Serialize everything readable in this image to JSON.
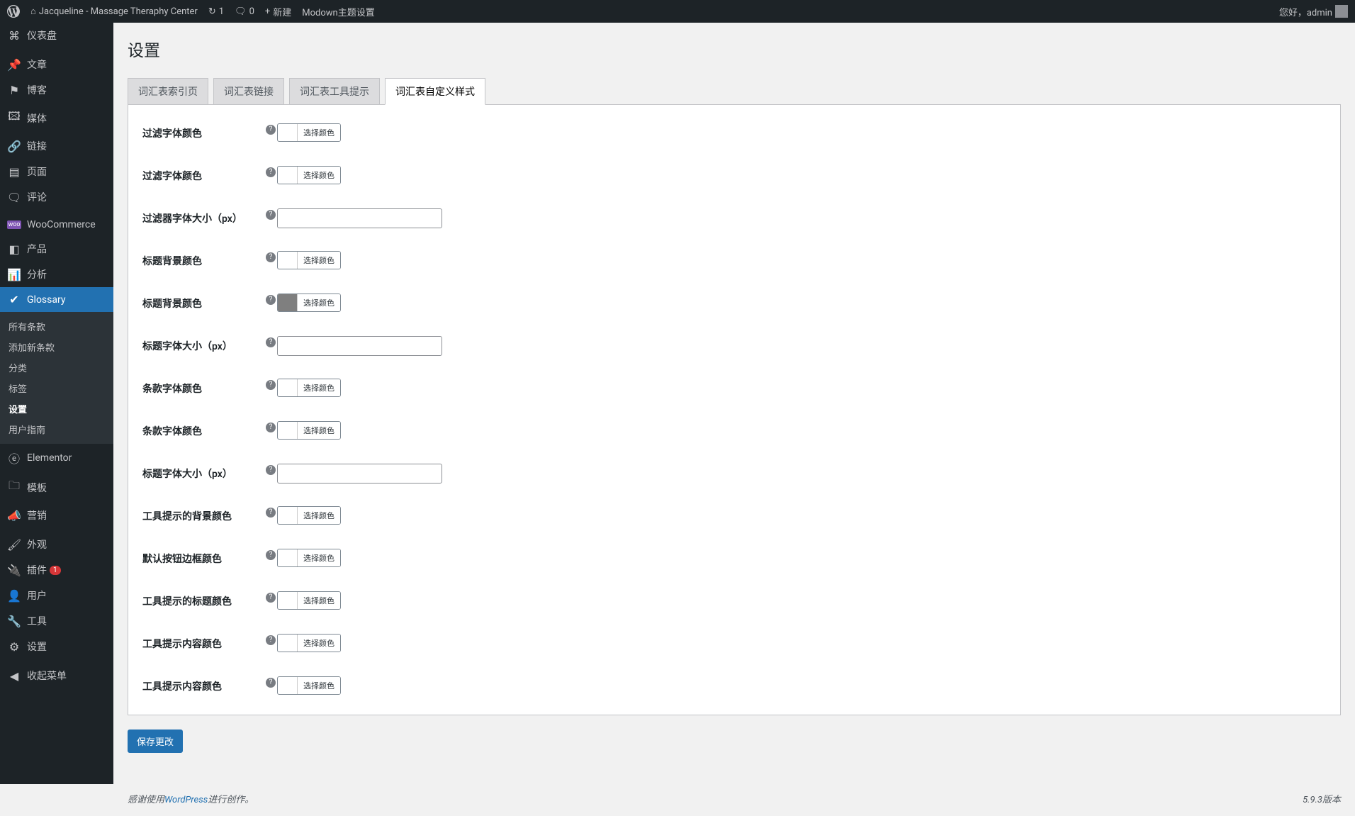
{
  "adminbar": {
    "site_name": "Jacqueline - Massage Theraphy Center",
    "updates": "1",
    "comments": "0",
    "new": "新建",
    "modown": "Modown主题设置",
    "howdy": "您好，admin"
  },
  "sidebar": {
    "dashboard": "仪表盘",
    "posts": "文章",
    "blog": "博客",
    "media": "媒体",
    "links": "链接",
    "pages": "页面",
    "comments": "评论",
    "woocommerce": "WooCommerce",
    "products": "产品",
    "analytics": "分析",
    "glossary": "Glossary",
    "glossary_sub": {
      "all": "所有条款",
      "add": "添加新条款",
      "cat": "分类",
      "tags": "标签",
      "settings": "设置",
      "guide": "用户指南"
    },
    "elementor": "Elementor",
    "templates": "模板",
    "marketing": "营销",
    "appearance": "外观",
    "plugins": "插件",
    "plugins_badge": "1",
    "users": "用户",
    "tools": "工具",
    "settings": "设置",
    "collapse": "收起菜单"
  },
  "page": {
    "title": "设置",
    "tabs": {
      "index": "词汇表索引页",
      "links": "词汇表链接",
      "tooltip": "词汇表工具提示",
      "custom": "词汇表自定义样式"
    },
    "fields": [
      {
        "label": "过滤字体颜色",
        "type": "color",
        "swatch": "transparent",
        "btn": "选择颜色"
      },
      {
        "label": "过滤字体颜色",
        "type": "color",
        "swatch": "transparent",
        "btn": "选择颜色"
      },
      {
        "label": "过滤器字体大小（px）",
        "type": "number",
        "value": ""
      },
      {
        "label": "标题背景颜色",
        "type": "color",
        "swatch": "transparent",
        "btn": "选择颜色"
      },
      {
        "label": "标题背景颜色",
        "type": "color",
        "swatch": "#7f7f7f",
        "btn": "选择颜色"
      },
      {
        "label": "标题字体大小（px）",
        "type": "number",
        "value": ""
      },
      {
        "label": "条款字体颜色",
        "type": "color",
        "swatch": "transparent",
        "btn": "选择颜色"
      },
      {
        "label": "条款字体颜色",
        "type": "color",
        "swatch": "transparent",
        "btn": "选择颜色"
      },
      {
        "label": "标题字体大小（px）",
        "type": "number",
        "value": ""
      },
      {
        "label": "工具提示的背景颜色",
        "type": "color",
        "swatch": "transparent",
        "btn": "选择颜色"
      },
      {
        "label": "默认按钮边框颜色",
        "type": "color",
        "swatch": "transparent",
        "btn": "选择颜色"
      },
      {
        "label": "工具提示的标题颜色",
        "type": "color",
        "swatch": "transparent",
        "btn": "选择颜色"
      },
      {
        "label": "工具提示内容颜色",
        "type": "color",
        "swatch": "transparent",
        "btn": "选择颜色"
      },
      {
        "label": "工具提示内容颜色",
        "type": "color",
        "swatch": "transparent",
        "btn": "选择颜色"
      }
    ],
    "save": "保存更改"
  },
  "footer": {
    "thanks_pre": "感谢使用",
    "wp": "WordPress",
    "thanks_post": "进行创作。",
    "version": "5.9.3版本"
  }
}
